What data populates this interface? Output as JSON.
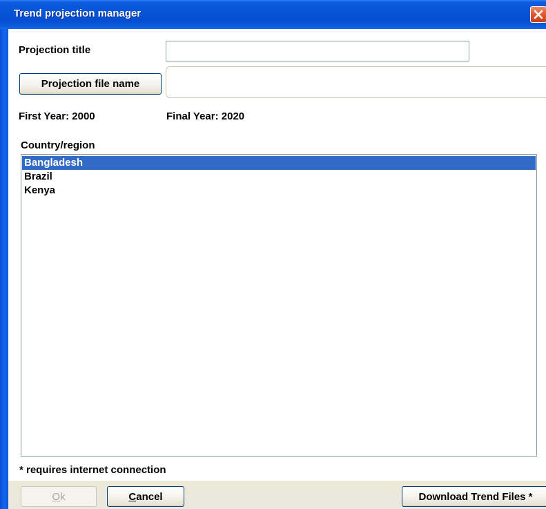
{
  "window": {
    "title": "Trend projection manager"
  },
  "form": {
    "projection_title_label": "Projection title",
    "projection_title_value": "",
    "projection_file_button": "Projection file name",
    "projection_file_value": "",
    "first_year_label": "First Year: 2000",
    "final_year_label": "Final Year: 2020",
    "country_label": "Country/region"
  },
  "countries": {
    "items": [
      "Bangladesh",
      "Brazil",
      "Kenya"
    ],
    "selected": "Bangladesh"
  },
  "footer": {
    "note": "* requires internet connection",
    "ok_mnemonic": "O",
    "ok_rest": "k",
    "cancel_mnemonic": "C",
    "cancel_rest": "ancel",
    "download_label": "Download Trend Files *"
  },
  "colors": {
    "title_bar": "#0753d6",
    "selection": "#316ac5",
    "close_button": "#e0562e"
  }
}
